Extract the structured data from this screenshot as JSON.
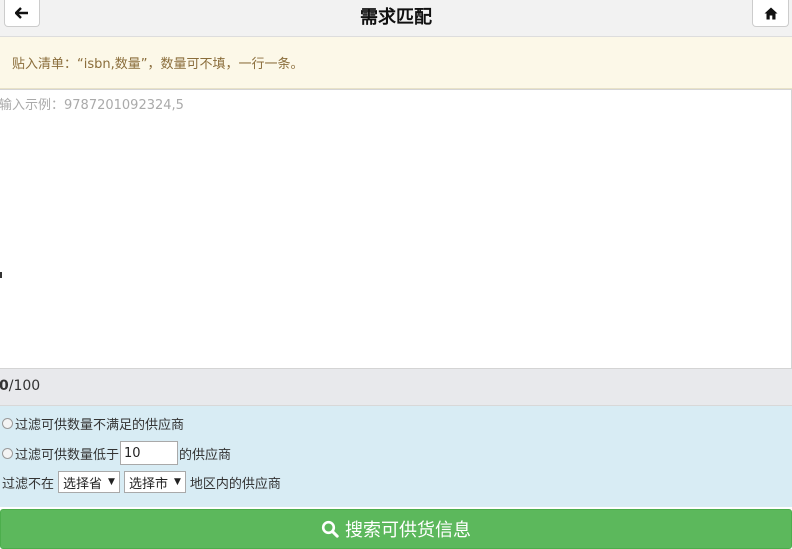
{
  "header": {
    "title": "需求匹配",
    "back_icon": "arrow-left-icon",
    "home_icon": "home-icon"
  },
  "notice": {
    "text": "贴入清单：“isbn,数量”，数量可不填，一行一条。"
  },
  "input": {
    "placeholder": "输入示例：9787201092324,5",
    "value": ""
  },
  "counter": {
    "current": "0",
    "max": "/100"
  },
  "filters": {
    "option1_label": "过滤可供数量不满足的供应商",
    "option2_prefix": "过滤可供数量低于",
    "option2_value": "10",
    "option2_suffix": "的供应商",
    "region_prefix": "过滤不在",
    "province_select": "选择省",
    "city_select": "选择市",
    "region_suffix": "地区内的供应商"
  },
  "search_button": {
    "label": "搜索可供货信息",
    "icon": "search-icon",
    "color": "#5cb85c"
  }
}
